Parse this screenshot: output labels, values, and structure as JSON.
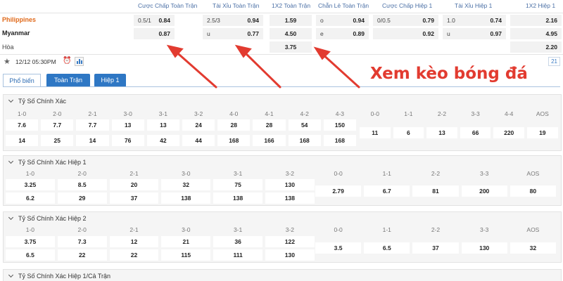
{
  "top": {
    "headers": [
      "Cược Chấp Toàn Trận",
      "Tài Xỉu Toàn Trận",
      "1X2 Toàn Trận",
      "Chẵn Lẻ Toàn Trận",
      "Cược Chấp Hiệp 1",
      "Tài Xỉu Hiệp 1",
      "1X2 Hiệp 1"
    ],
    "teams": [
      "Philippines",
      "Myanmar",
      "Hòa"
    ],
    "rows": [
      [
        "0.5/1",
        "0.84",
        "2.5/3",
        "0.94",
        "1.59",
        "o",
        "0.94",
        "0/0.5",
        "0.79",
        "1.0",
        "0.74",
        "2.16"
      ],
      [
        "",
        "0.87",
        "u",
        "0.77",
        "4.50",
        "e",
        "0.89",
        "",
        "0.92",
        "u",
        "0.97",
        "4.95"
      ],
      [
        "",
        "",
        "",
        "",
        "3.75",
        "",
        "",
        "",
        "",
        "",
        "",
        "2.20"
      ]
    ]
  },
  "meta": {
    "datetime": "12/12 05:30PM",
    "counter": "21"
  },
  "tabs": [
    "Phổ biến",
    "Toàn Trận",
    "Hiệp 1"
  ],
  "promo": "Xem kèo bóng đá",
  "sections": [
    {
      "title": "Tỷ Số Chính Xác",
      "headers": [
        "1-0",
        "2-0",
        "2-1",
        "3-0",
        "3-1",
        "3-2",
        "4-0",
        "4-1",
        "4-2",
        "4-3",
        "0-0",
        "1-1",
        "2-2",
        "3-3",
        "4-4",
        "AOS"
      ],
      "row1": [
        "7.6",
        "7.7",
        "7.7",
        "13",
        "13",
        "24",
        "28",
        "28",
        "54",
        "150"
      ],
      "row2": [
        "14",
        "25",
        "14",
        "76",
        "42",
        "44",
        "168",
        "166",
        "168",
        "168"
      ],
      "draws": [
        "11",
        "6",
        "13",
        "66",
        "220",
        "19"
      ]
    },
    {
      "title": "Tỷ Số Chính Xác Hiệp 1",
      "headers": [
        "1-0",
        "2-0",
        "2-1",
        "3-0",
        "3-1",
        "3-2",
        "0-0",
        "1-1",
        "2-2",
        "3-3",
        "AOS"
      ],
      "row1": [
        "3.25",
        "8.5",
        "20",
        "32",
        "75",
        "130"
      ],
      "row2": [
        "6.2",
        "29",
        "37",
        "138",
        "138",
        "138"
      ],
      "draws": [
        "2.79",
        "6.7",
        "81",
        "200",
        "80"
      ]
    },
    {
      "title": "Tỷ Số Chính Xác Hiệp 2",
      "headers": [
        "1-0",
        "2-0",
        "2-1",
        "3-0",
        "3-1",
        "3-2",
        "0-0",
        "1-1",
        "2-2",
        "3-3",
        "AOS"
      ],
      "row1": [
        "3.75",
        "7.3",
        "12",
        "21",
        "36",
        "122"
      ],
      "row2": [
        "6.5",
        "22",
        "22",
        "115",
        "111",
        "130"
      ],
      "draws": [
        "3.5",
        "6.5",
        "37",
        "130",
        "32"
      ]
    },
    {
      "title": "Tỷ Số Chính Xác Hiệp 1/Cả Trận"
    }
  ],
  "colors": {
    "team_home": "#e06a1b",
    "accent": "#2e77c4",
    "annotation": "#e23b30"
  }
}
